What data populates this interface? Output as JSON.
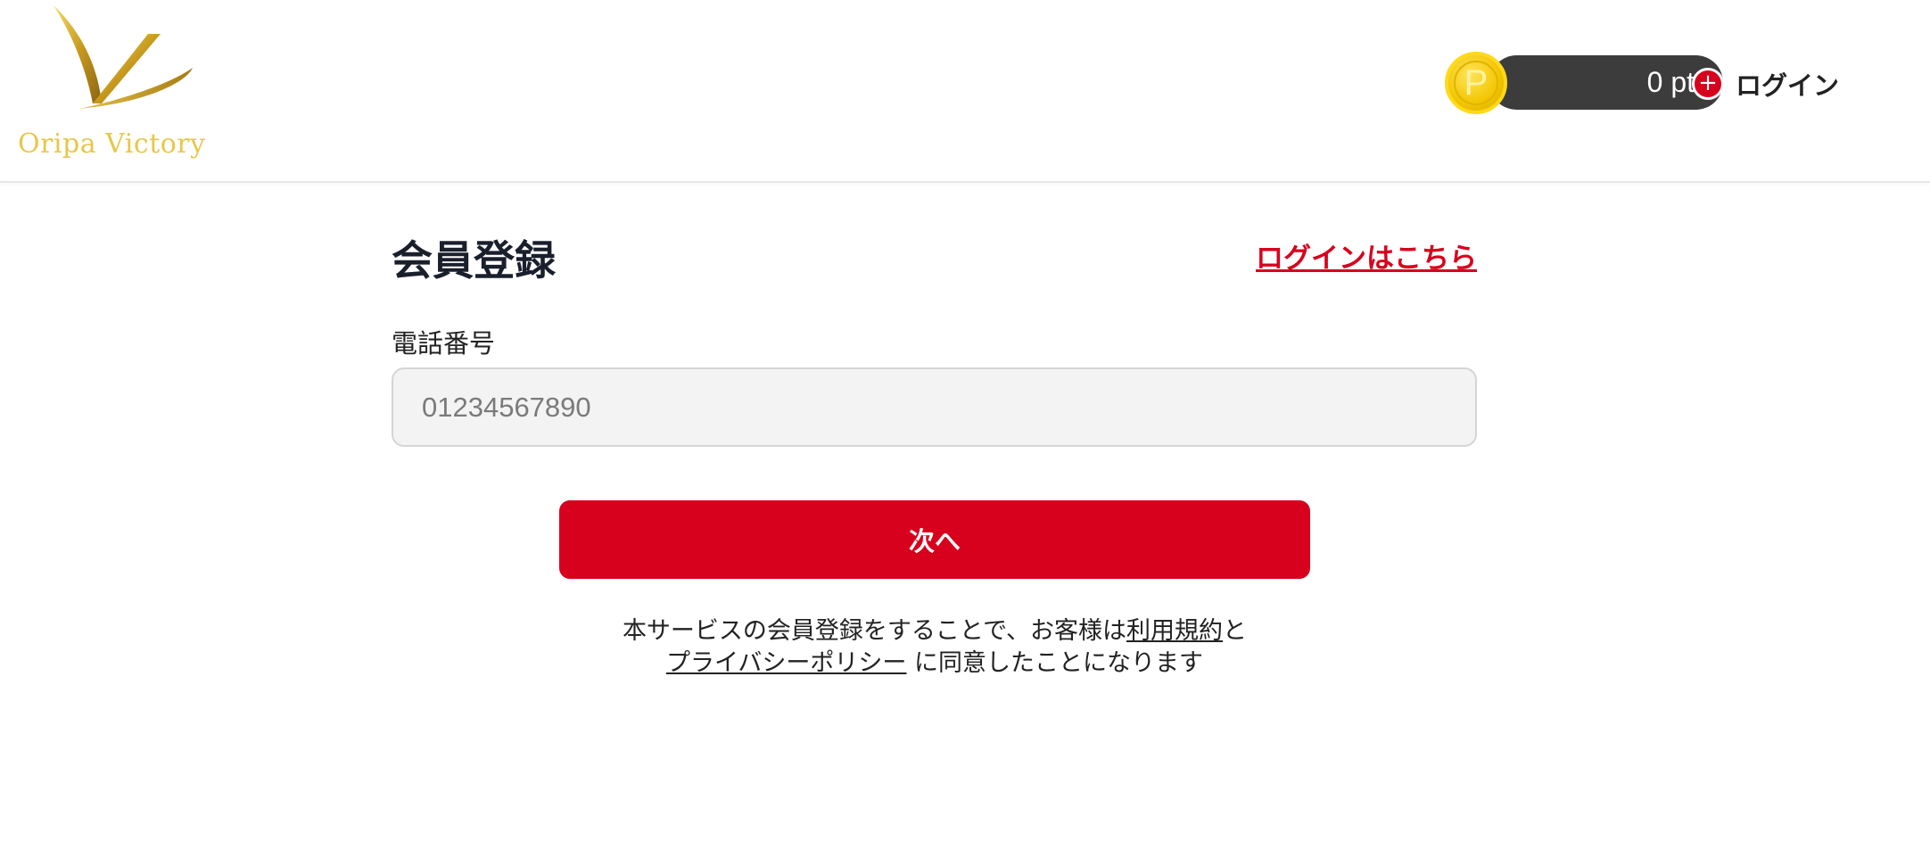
{
  "header": {
    "logo_text": "Oripa Victory",
    "points_value": "0 pt",
    "coin_letter": "P",
    "add_symbol": "+",
    "login_label": "ログイン"
  },
  "main": {
    "title": "会員登録",
    "login_here_link": "ログインはこちら",
    "phone_label": "電話番号",
    "phone_placeholder": "01234567890",
    "next_button": "次へ"
  },
  "terms": {
    "prefix": "本サービスの会員登録をすることで、お客様は",
    "terms_link": "利用規約",
    "connector": "と",
    "privacy_link": "プライバシーポリシー",
    "suffix": " に同意したことになります"
  },
  "colors": {
    "accent_red": "#d7001d",
    "gold": "#e7c74a",
    "pill_dark": "#3c3c3c"
  }
}
